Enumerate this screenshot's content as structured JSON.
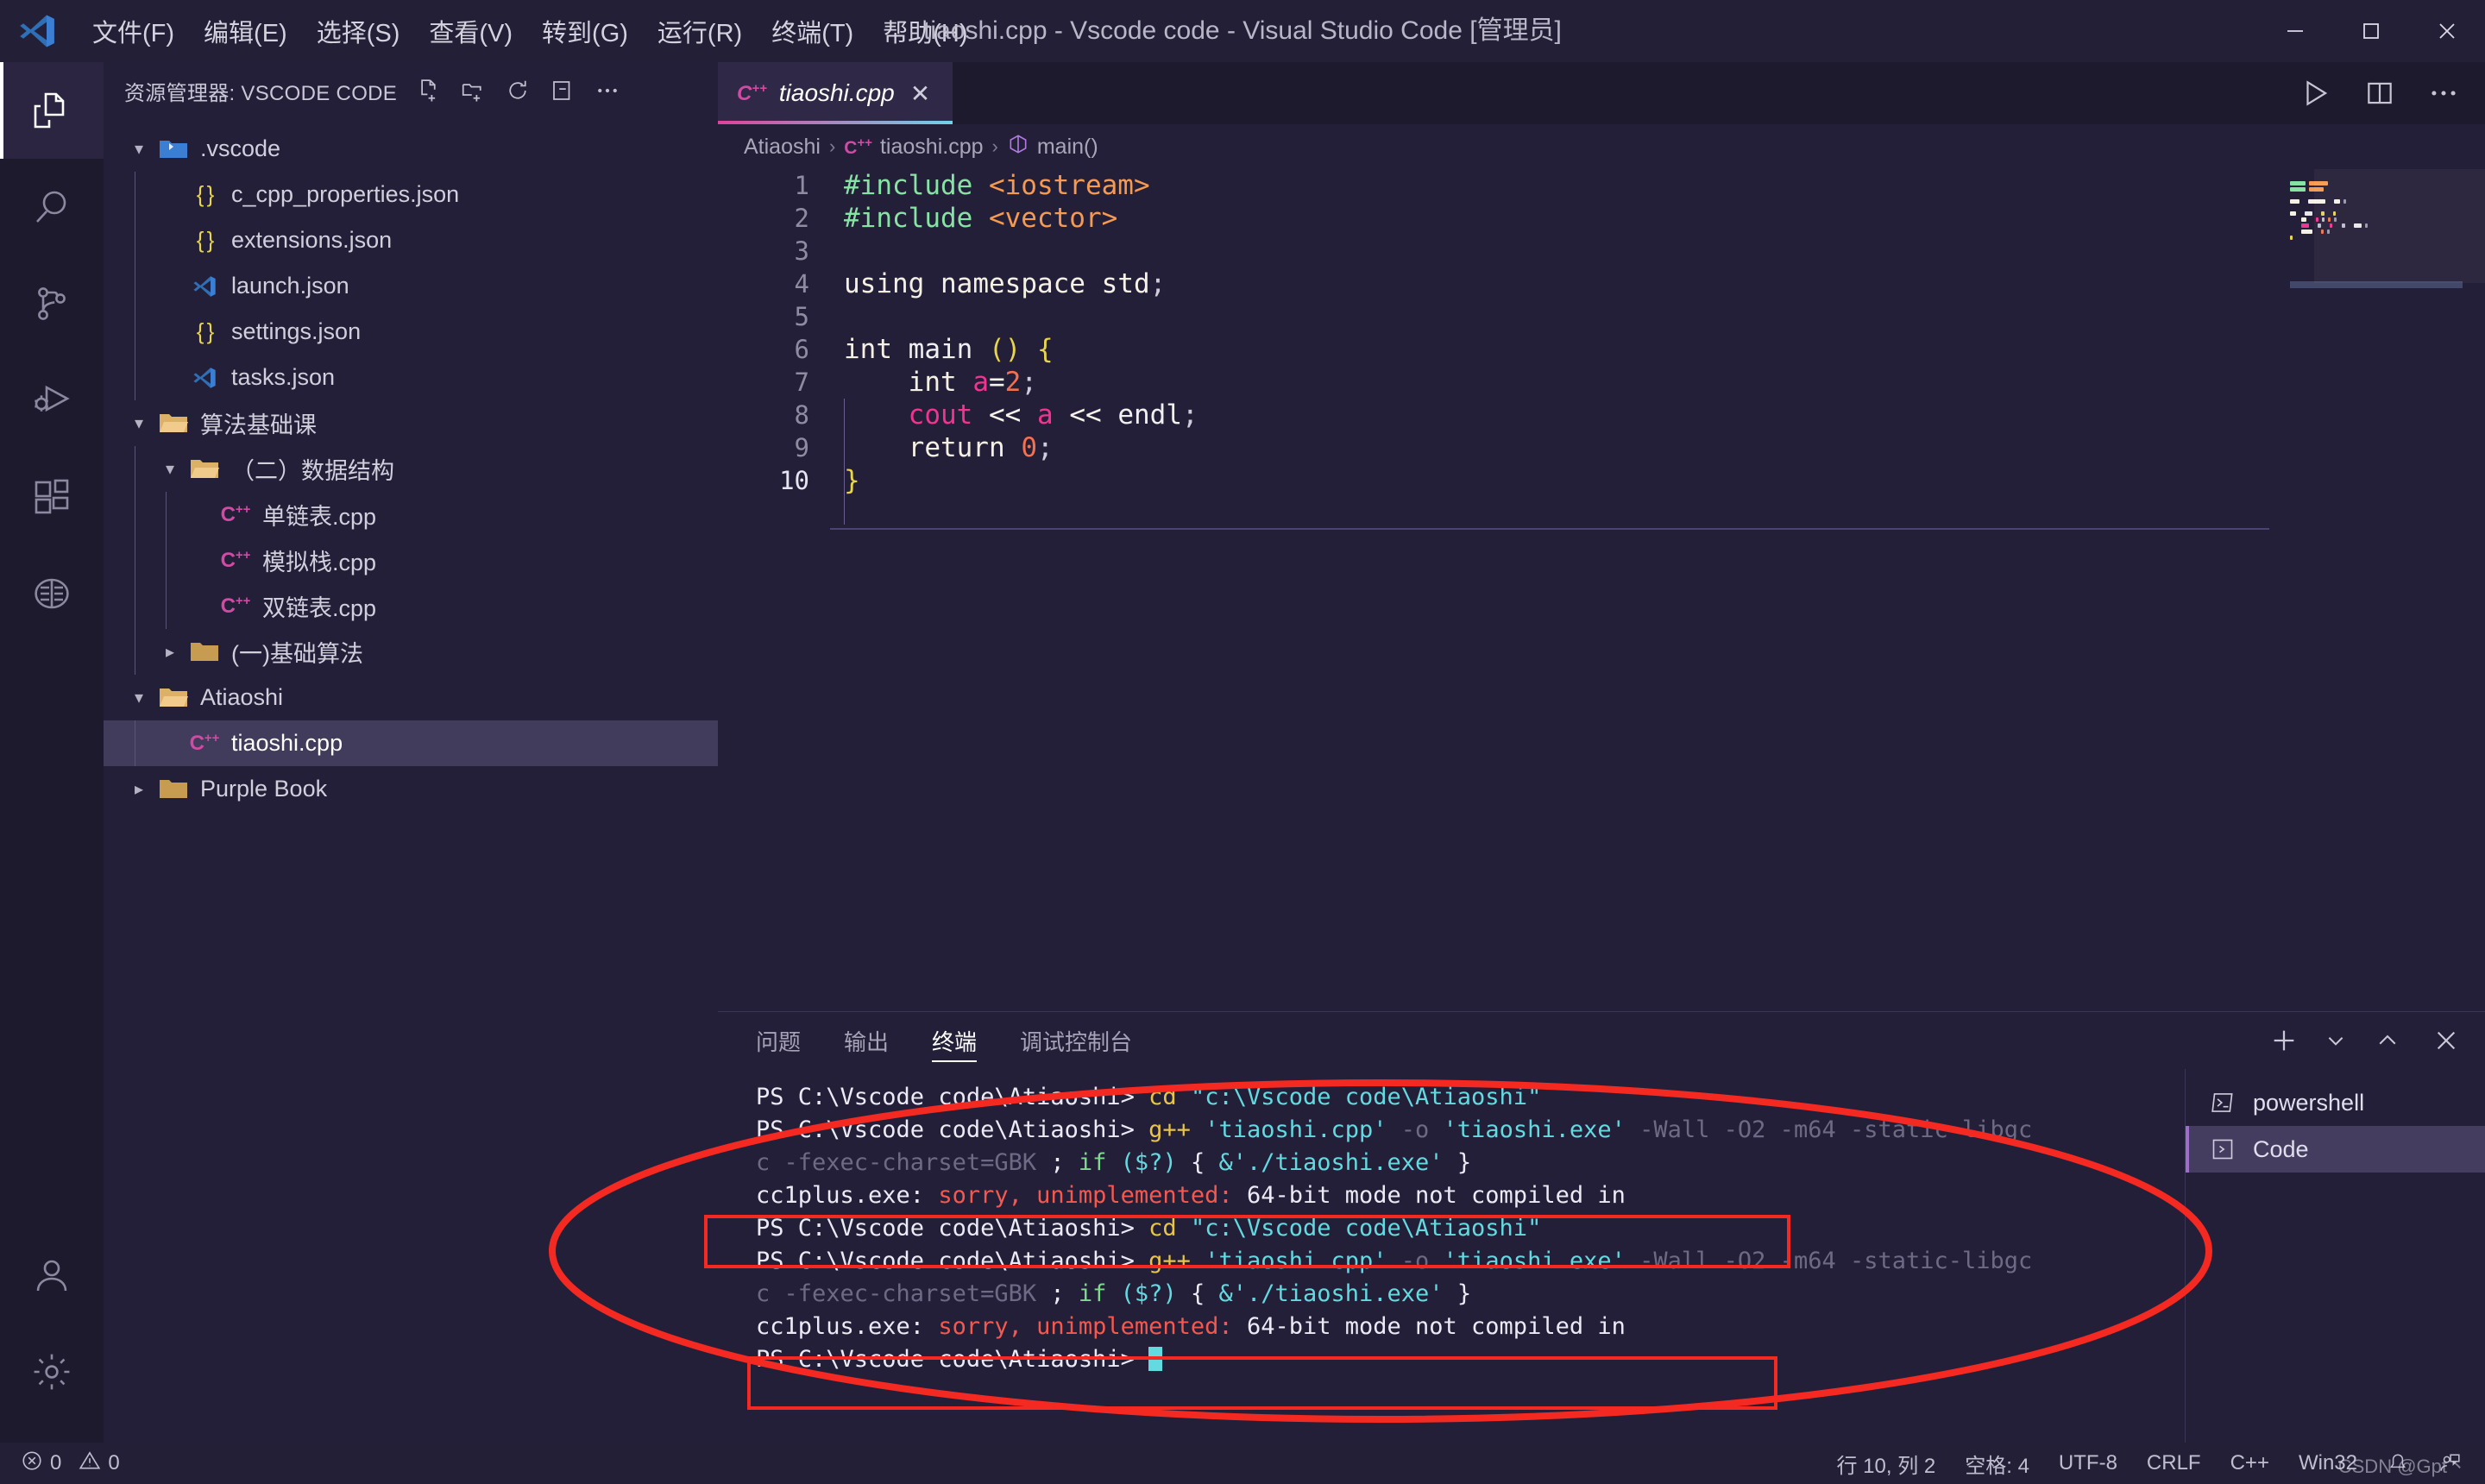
{
  "window": {
    "title": "tiaoshi.cpp - Vscode code - Visual Studio Code [管理员]",
    "logo": "vscode-logo",
    "minimize": "–",
    "maximize": "▢",
    "close": "✕"
  },
  "menu": {
    "items": [
      {
        "label": "文件(F)",
        "name": "menu-file"
      },
      {
        "label": "编辑(E)",
        "name": "menu-edit"
      },
      {
        "label": "选择(S)",
        "name": "menu-selection"
      },
      {
        "label": "查看(V)",
        "name": "menu-view"
      },
      {
        "label": "转到(G)",
        "name": "menu-go"
      },
      {
        "label": "运行(R)",
        "name": "menu-run"
      },
      {
        "label": "终端(T)",
        "name": "menu-terminal"
      },
      {
        "label": "帮助(H)",
        "name": "menu-help"
      }
    ]
  },
  "activitybar": {
    "items": [
      {
        "icon": "files-explorer-icon",
        "active": true
      },
      {
        "icon": "search-icon",
        "active": false
      },
      {
        "icon": "source-control-icon",
        "active": false
      },
      {
        "icon": "run-and-debug-icon",
        "active": false
      },
      {
        "icon": "extensions-icon",
        "active": false
      },
      {
        "icon": "remote-explorer-icon",
        "active": false
      }
    ],
    "bottom": [
      {
        "icon": "account-icon"
      },
      {
        "icon": "gear-icon"
      }
    ]
  },
  "explorer": {
    "title": "资源管理器: VSCODE CODE",
    "actions": [
      {
        "icon": "new-file-icon"
      },
      {
        "icon": "new-folder-icon"
      },
      {
        "icon": "refresh-icon"
      },
      {
        "icon": "collapse-all-icon"
      },
      {
        "icon": "more-actions-icon"
      }
    ],
    "tree": [
      {
        "label": ".vscode",
        "indent": 0,
        "type": "folder",
        "twisty": "▾",
        "icon": "vscode-folder-icon",
        "selected": false
      },
      {
        "label": "c_cpp_properties.json",
        "indent": 1,
        "type": "json",
        "twisty": "",
        "icon": "json-icon",
        "selected": false
      },
      {
        "label": "extensions.json",
        "indent": 1,
        "type": "json",
        "twisty": "",
        "icon": "json-icon",
        "selected": false
      },
      {
        "label": "launch.json",
        "indent": 1,
        "type": "vsc",
        "twisty": "",
        "icon": "vscode-file-icon",
        "selected": false
      },
      {
        "label": "settings.json",
        "indent": 1,
        "type": "json",
        "twisty": "",
        "icon": "json-icon",
        "selected": false
      },
      {
        "label": "tasks.json",
        "indent": 1,
        "type": "vsc",
        "twisty": "",
        "icon": "vscode-file-icon",
        "selected": false
      },
      {
        "label": "算法基础课",
        "indent": 0,
        "type": "folder",
        "twisty": "▾",
        "icon": "folder-open-icon",
        "selected": false
      },
      {
        "label": "（二）数据结构",
        "indent": 1,
        "type": "folder",
        "twisty": "▾",
        "icon": "folder-open-icon",
        "selected": false
      },
      {
        "label": "单链表.cpp",
        "indent": 2,
        "type": "cpp",
        "twisty": "",
        "icon": "cpp-icon",
        "selected": false
      },
      {
        "label": "模拟栈.cpp",
        "indent": 2,
        "type": "cpp",
        "twisty": "",
        "icon": "cpp-icon",
        "selected": false
      },
      {
        "label": "双链表.cpp",
        "indent": 2,
        "type": "cpp",
        "twisty": "",
        "icon": "cpp-icon",
        "selected": false
      },
      {
        "label": "(一)基础算法",
        "indent": 1,
        "type": "folder",
        "twisty": "▸",
        "icon": "folder-closed-icon",
        "selected": false
      },
      {
        "label": "Atiaoshi",
        "indent": 0,
        "type": "folder",
        "twisty": "▾",
        "icon": "folder-open-icon",
        "selected": false
      },
      {
        "label": "tiaoshi.cpp",
        "indent": 1,
        "type": "cpp",
        "twisty": "",
        "icon": "cpp-icon",
        "selected": true
      },
      {
        "label": "Purple Book",
        "indent": 0,
        "type": "folder",
        "twisty": "▸",
        "icon": "folder-closed-icon",
        "selected": false
      }
    ]
  },
  "editor": {
    "tab": {
      "label": "tiaoshi.cpp",
      "icon": "cpp-icon",
      "close": "✕"
    },
    "actions": [
      {
        "icon": "run-code-icon"
      },
      {
        "icon": "split-editor-icon"
      },
      {
        "icon": "more-actions-icon"
      }
    ],
    "breadcrumb": [
      {
        "label": "Atiaoshi",
        "icon": ""
      },
      {
        "label": "tiaoshi.cpp",
        "icon": "cpp-icon"
      },
      {
        "label": "main()",
        "icon": "symbol-method-icon"
      }
    ],
    "breadcrumb_separator": "›",
    "lines": [
      {
        "n": "1",
        "tokens": [
          {
            "t": "#include ",
            "c": "pp"
          },
          {
            "t": "<iostream>",
            "c": "hdr"
          }
        ]
      },
      {
        "n": "2",
        "tokens": [
          {
            "t": "#include ",
            "c": "pp"
          },
          {
            "t": "<vector>",
            "c": "hdr"
          }
        ]
      },
      {
        "n": "3",
        "tokens": []
      },
      {
        "n": "4",
        "tokens": [
          {
            "t": "using",
            "c": "kw"
          },
          {
            "t": " ",
            "c": "op"
          },
          {
            "t": "namespace",
            "c": "kw"
          },
          {
            "t": " ",
            "c": "op"
          },
          {
            "t": "std",
            "c": "type"
          },
          {
            "t": ";",
            "c": "semi"
          }
        ]
      },
      {
        "n": "5",
        "tokens": []
      },
      {
        "n": "6",
        "tokens": [
          {
            "t": "int",
            "c": "kw"
          },
          {
            "t": " ",
            "c": "op"
          },
          {
            "t": "main",
            "c": "fn"
          },
          {
            "t": " ",
            "c": "op"
          },
          {
            "t": "()",
            "c": "brace-y"
          },
          {
            "t": " ",
            "c": "op"
          },
          {
            "t": "{",
            "c": "brace-y"
          }
        ]
      },
      {
        "n": "7",
        "tokens": [
          {
            "t": "    ",
            "c": "op"
          },
          {
            "t": "int",
            "c": "kw"
          },
          {
            "t": " ",
            "c": "op"
          },
          {
            "t": "a",
            "c": "var"
          },
          {
            "t": "=",
            "c": "op"
          },
          {
            "t": "2",
            "c": "num"
          },
          {
            "t": ";",
            "c": "semi"
          }
        ]
      },
      {
        "n": "8",
        "tokens": [
          {
            "t": "    ",
            "c": "op"
          },
          {
            "t": "cout",
            "c": "stream"
          },
          {
            "t": " ",
            "c": "op"
          },
          {
            "t": "<<",
            "c": "op"
          },
          {
            "t": " ",
            "c": "op"
          },
          {
            "t": "a",
            "c": "var"
          },
          {
            "t": " ",
            "c": "op"
          },
          {
            "t": "<<",
            "c": "op"
          },
          {
            "t": " ",
            "c": "op"
          },
          {
            "t": "endl",
            "c": "fn"
          },
          {
            "t": ";",
            "c": "semi"
          }
        ]
      },
      {
        "n": "9",
        "tokens": [
          {
            "t": "    ",
            "c": "op"
          },
          {
            "t": "return",
            "c": "kw"
          },
          {
            "t": " ",
            "c": "op"
          },
          {
            "t": "0",
            "c": "num"
          },
          {
            "t": ";",
            "c": "semi"
          }
        ]
      },
      {
        "n": "10",
        "tokens": [
          {
            "t": "}",
            "c": "brace-y"
          }
        ],
        "current": true
      }
    ]
  },
  "panel": {
    "tabs": [
      {
        "label": "问题",
        "active": false
      },
      {
        "label": "输出",
        "active": false
      },
      {
        "label": "终端",
        "active": true
      },
      {
        "label": "调试控制台",
        "active": false
      }
    ],
    "actions": [
      {
        "icon": "add-terminal-icon"
      },
      {
        "icon": "chevron-down-icon"
      },
      {
        "icon": "chevron-up-icon"
      },
      {
        "icon": "close-icon"
      }
    ],
    "terminal_lines": [
      [
        {
          "t": "PS C:\\Vscode code\\Atiaoshi> ",
          "c": "t-white"
        },
        {
          "t": "cd ",
          "c": "t-yellow"
        },
        {
          "t": "\"c:\\Vscode code\\Atiaoshi\"",
          "c": "t-cyan"
        }
      ],
      [
        {
          "t": "PS C:\\Vscode code\\Atiaoshi> ",
          "c": "t-white"
        },
        {
          "t": "g++ ",
          "c": "t-yellow"
        },
        {
          "t": "'tiaoshi.cpp'",
          "c": "t-cyan"
        },
        {
          "t": " -o ",
          "c": "t-grey"
        },
        {
          "t": "'tiaoshi.exe'",
          "c": "t-cyan"
        },
        {
          "t": " -Wall -O2 -m64 -static-libgc",
          "c": "t-grey"
        }
      ],
      [
        {
          "t": "c -fexec-charset=GBK",
          "c": "t-grey"
        },
        {
          "t": " ; ",
          "c": "t-white"
        },
        {
          "t": "if ",
          "c": "t-green"
        },
        {
          "t": "($?)",
          "c": "t-cyan"
        },
        {
          "t": " { ",
          "c": "t-white"
        },
        {
          "t": "&'./tiaoshi.exe'",
          "c": "t-cyan"
        },
        {
          "t": " }",
          "c": "t-white"
        }
      ],
      [
        {
          "t": "cc1plus.exe: ",
          "c": "t-white"
        },
        {
          "t": "sorry, unimplemented:",
          "c": "t-red"
        },
        {
          "t": " 64-bit mode not compiled in",
          "c": "t-white"
        }
      ],
      [
        {
          "t": "PS C:\\Vscode code\\Atiaoshi> ",
          "c": "t-white"
        },
        {
          "t": "cd ",
          "c": "t-yellow"
        },
        {
          "t": "\"c:\\Vscode code\\Atiaoshi\"",
          "c": "t-cyan"
        }
      ],
      [
        {
          "t": "PS C:\\Vscode code\\Atiaoshi> ",
          "c": "t-white"
        },
        {
          "t": "g++ ",
          "c": "t-yellow"
        },
        {
          "t": "'tiaoshi.cpp'",
          "c": "t-cyan"
        },
        {
          "t": " -o ",
          "c": "t-grey"
        },
        {
          "t": "'tiaoshi.exe'",
          "c": "t-cyan"
        },
        {
          "t": " -Wall -O2 -m64 -static-libgc",
          "c": "t-grey"
        }
      ],
      [
        {
          "t": "c -fexec-charset=GBK",
          "c": "t-grey"
        },
        {
          "t": " ; ",
          "c": "t-white"
        },
        {
          "t": "if ",
          "c": "t-green"
        },
        {
          "t": "($?)",
          "c": "t-cyan"
        },
        {
          "t": " { ",
          "c": "t-white"
        },
        {
          "t": "&'./tiaoshi.exe'",
          "c": "t-cyan"
        },
        {
          "t": " }",
          "c": "t-white"
        }
      ],
      [
        {
          "t": "cc1plus.exe: ",
          "c": "t-white"
        },
        {
          "t": "sorry, unimplemented:",
          "c": "t-red"
        },
        {
          "t": " 64-bit mode not compiled in",
          "c": "t-white"
        }
      ],
      [
        {
          "t": "PS C:\\Vscode code\\Atiaoshi> ",
          "c": "t-white"
        },
        {
          "t": "__CURSOR__",
          "c": "t-cursor"
        }
      ]
    ],
    "terminal_list": [
      {
        "label": "powershell",
        "icon": "powershell-icon",
        "active": false
      },
      {
        "label": "Code",
        "icon": "terminal-icon",
        "active": true
      }
    ]
  },
  "statusbar": {
    "errors_icon": "error-circle-icon",
    "errors": "0",
    "warnings_icon": "warning-triangle-icon",
    "warnings": "0",
    "right": [
      {
        "label": "行 10, 列 2",
        "name": "cursor-position"
      },
      {
        "label": "空格: 4",
        "name": "indentation"
      },
      {
        "label": "UTF-8",
        "name": "encoding"
      },
      {
        "label": "CRLF",
        "name": "eol"
      },
      {
        "label": "C++",
        "name": "language-mode"
      },
      {
        "label": "Win32",
        "name": "platform"
      }
    ],
    "bell_icon": "bell-icon",
    "feedback_icon": "feedback-icon"
  },
  "watermark": "CSDN @Gpt丶",
  "annotations": {
    "color": "#f42a22",
    "ellipse_label": "terminal-error-ellipse",
    "box_labels": [
      "error-box-1",
      "error-box-2"
    ]
  },
  "colors": {
    "accent_pink": "#e0419c",
    "accent_cyan": "#6fd3e8",
    "bg": "#24203a",
    "sidebar_bg": "#241f38",
    "activitybar_bg": "#1e1a2e",
    "selection": "#413b5c",
    "error_red": "#f42a22"
  }
}
